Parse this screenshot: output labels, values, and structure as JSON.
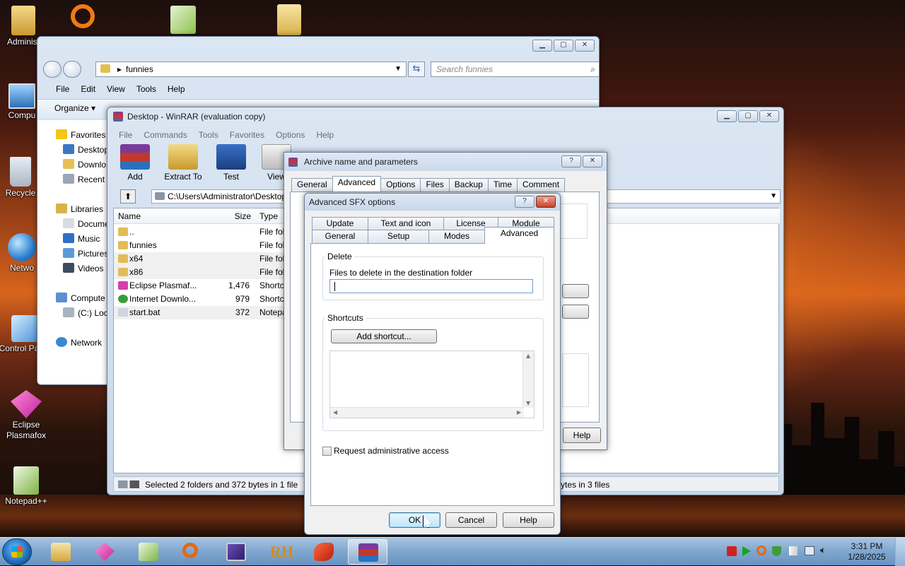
{
  "desktop": {
    "icons": [
      {
        "label": "Administ"
      },
      {
        "label": "Compu"
      },
      {
        "label": "Recycle"
      },
      {
        "label": "Netwo"
      },
      {
        "label": "Control Panel"
      },
      {
        "label": "Eclipse Plasmafox"
      },
      {
        "label": "Notepad++"
      }
    ]
  },
  "explorer": {
    "address": "funnies",
    "search_placeholder": "Search funnies",
    "menu": [
      "File",
      "Edit",
      "View",
      "Tools",
      "Help"
    ],
    "organize": "Organize ▾",
    "nav": [
      "Favorites",
      "Desktop",
      "Downlo",
      "Recent l",
      "Libraries",
      "Docume",
      "Music",
      "Pictures",
      "Videos",
      "Compute",
      "(C:) Loc",
      "Network"
    ]
  },
  "winrar": {
    "title": "Desktop - WinRAR (evaluation copy)",
    "menu": [
      "File",
      "Commands",
      "Tools",
      "Favorites",
      "Options",
      "Help"
    ],
    "tools": [
      "Add",
      "Extract To",
      "Test",
      "View"
    ],
    "path": "C:\\Users\\Administrator\\Desktop",
    "columns": {
      "name": "Name",
      "size": "Size",
      "type": "Type"
    },
    "files": [
      {
        "name": "..",
        "size": "",
        "type": "File fol"
      },
      {
        "name": "funnies",
        "size": "",
        "type": "File fol"
      },
      {
        "name": "x64",
        "size": "",
        "type": "File fol"
      },
      {
        "name": "x86",
        "size": "",
        "type": "File fol"
      },
      {
        "name": "Eclipse Plasmaf...",
        "size": "1,476",
        "type": "Shortc"
      },
      {
        "name": "Internet Downlo...",
        "size": "979",
        "type": "Shortc"
      },
      {
        "name": "start.bat",
        "size": "372",
        "type": "Notepa"
      }
    ],
    "status_left": "Selected 2 folders and 372 bytes in 1 file",
    "status_right": "ytes in 3 files"
  },
  "archive_dialog": {
    "title": "Archive name and parameters",
    "tabs": [
      "General",
      "Advanced",
      "Options",
      "Files",
      "Backup",
      "Time",
      "Comment"
    ],
    "active_tab": "Advanced",
    "help_label": "Help",
    "help_glyph": "?",
    "close_glyph": "✕"
  },
  "sfx_dialog": {
    "title": "Advanced SFX options",
    "tabs_top": [
      "Update",
      "Text and icon",
      "License",
      "Module"
    ],
    "tabs_bottom": [
      "General",
      "Setup",
      "Modes",
      "Advanced"
    ],
    "active_tab": "Advanced",
    "delete_group": "Delete",
    "delete_label": "Files to delete in the destination folder",
    "delete_value": "",
    "shortcuts_group": "Shortcuts",
    "add_shortcut": "Add shortcut...",
    "request_admin": "Request administrative access",
    "request_admin_checked": false,
    "ok": "OK",
    "cancel": "Cancel",
    "help": "Help"
  },
  "taskbar": {
    "time": "3:31 PM",
    "date": "1/28/2025"
  }
}
